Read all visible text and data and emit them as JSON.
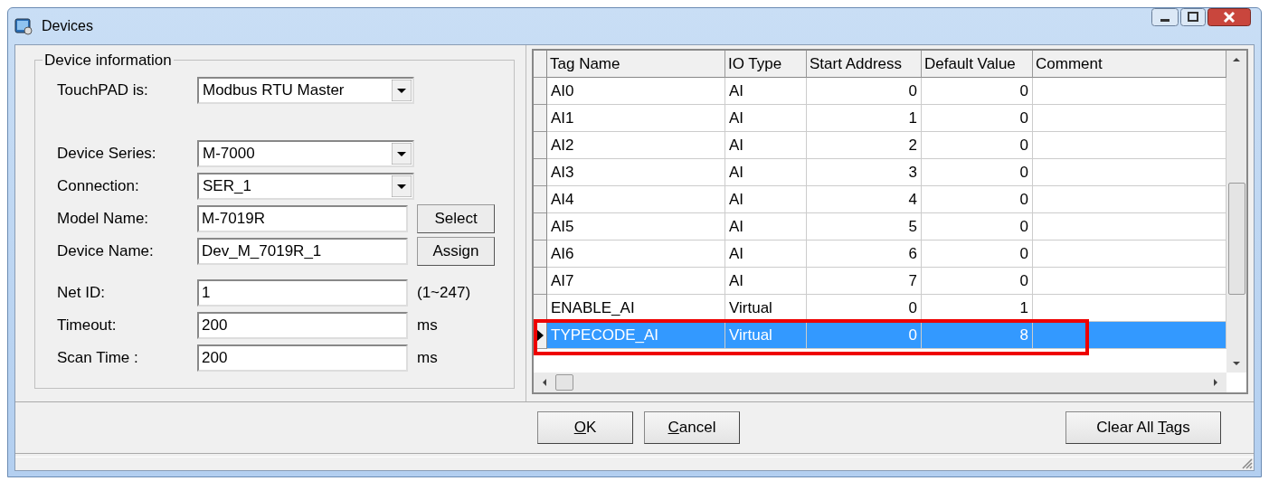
{
  "window": {
    "title": "Devices"
  },
  "device_info": {
    "legend": "Device information",
    "field_groups": [
      [
        {
          "label": "TouchPAD is:",
          "kind": "combo",
          "value": "Modbus RTU Master"
        }
      ],
      [
        {
          "label": "Device Series:",
          "kind": "combo",
          "value": "M-7000"
        },
        {
          "label": "Connection:",
          "kind": "combo",
          "value": "SER_1"
        },
        {
          "label": "Model Name:",
          "kind": "text",
          "value": "M-7019R",
          "button": "Select"
        },
        {
          "label": "Device Name:",
          "kind": "text",
          "value": "Dev_M_7019R_1",
          "button": "Assign"
        }
      ],
      [
        {
          "label": "Net ID:",
          "kind": "text",
          "value": "1",
          "suffix": "(1~247)"
        },
        {
          "label": "Timeout:",
          "kind": "text",
          "value": "200",
          "suffix": "ms"
        },
        {
          "label": "Scan Time :",
          "kind": "text",
          "value": "200",
          "suffix": "ms"
        }
      ]
    ]
  },
  "table": {
    "columns": [
      "Tag Name",
      "IO Type",
      "Start Address",
      "Default Value",
      "Comment"
    ],
    "rows": [
      {
        "cells": [
          "AI0",
          "AI",
          "0",
          "0"
        ],
        "selected": false,
        "highlighted": false
      },
      {
        "cells": [
          "AI1",
          "AI",
          "1",
          "0"
        ],
        "selected": false,
        "highlighted": false
      },
      {
        "cells": [
          "AI2",
          "AI",
          "2",
          "0"
        ],
        "selected": false,
        "highlighted": false
      },
      {
        "cells": [
          "AI3",
          "AI",
          "3",
          "0"
        ],
        "selected": false,
        "highlighted": false
      },
      {
        "cells": [
          "AI4",
          "AI",
          "4",
          "0"
        ],
        "selected": false,
        "highlighted": false
      },
      {
        "cells": [
          "AI5",
          "AI",
          "5",
          "0"
        ],
        "selected": false,
        "highlighted": false
      },
      {
        "cells": [
          "AI6",
          "AI",
          "6",
          "0"
        ],
        "selected": false,
        "highlighted": false
      },
      {
        "cells": [
          "AI7",
          "AI",
          "7",
          "0"
        ],
        "selected": false,
        "highlighted": false
      },
      {
        "cells": [
          "ENABLE_AI",
          "Virtual",
          "0",
          "1"
        ],
        "selected": false,
        "highlighted": false
      },
      {
        "cells": [
          "TYPECODE_AI",
          "Virtual",
          "0",
          "8"
        ],
        "selected": true,
        "highlighted": true
      }
    ]
  },
  "buttons": [
    {
      "key": "O",
      "post": "K"
    },
    {
      "key": "C",
      "post": "ancel"
    },
    {
      "pre": "Clear All ",
      "key": "T",
      "post": "ags"
    }
  ]
}
